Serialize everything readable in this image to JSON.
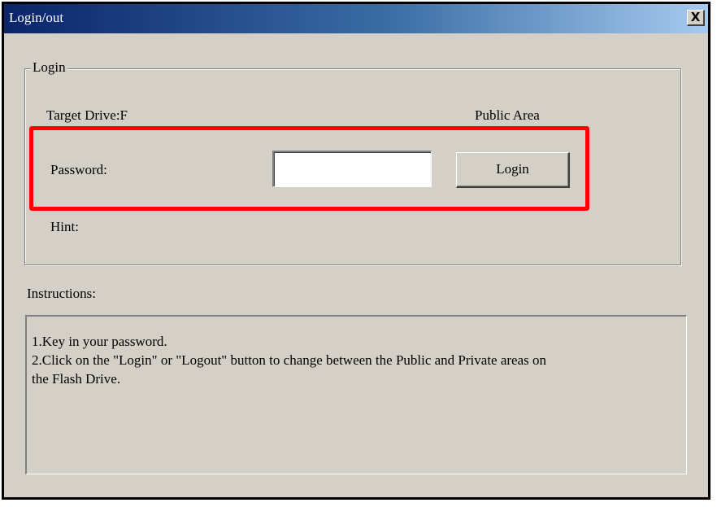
{
  "window": {
    "title": "Login/out",
    "close_label": "X"
  },
  "login_group": {
    "legend": "Login",
    "target_drive": "Target Drive:F",
    "area": "Public Area",
    "password_label": "Password:",
    "password_value": "",
    "login_button": "Login",
    "hint_label": "Hint:"
  },
  "instructions": {
    "heading": "Instructions:",
    "lines": [
      "1.Key in your password.",
      "2.Click on the \"Login\" or \"Logout\" button to change between the Public and Private areas on",
      "the Flash Drive."
    ]
  },
  "annotation": {
    "highlight_color": "#ff0000"
  },
  "colors": {
    "face": "#d4d0c8",
    "title_start": "#0a246a",
    "title_end": "#a6caf0"
  }
}
